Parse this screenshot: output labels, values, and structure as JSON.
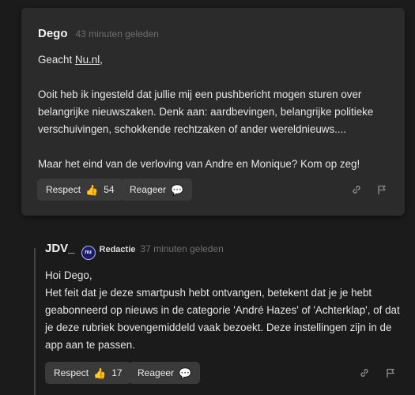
{
  "comment": {
    "author": "Dego",
    "time": "43 minuten geleden",
    "greeting_prefix": "Geacht ",
    "greeting_link": "Nu.nl",
    "greeting_suffix": ",",
    "lines": [
      "Ooit heb ik ingesteld dat jullie mij een pushbericht mogen sturen over",
      "belangrijke nieuwszaken. Denk aan: aardbevingen, belangrijke politieke",
      "verschuivingen, schokkende rechtzaken of ander wereldnieuws...."
    ],
    "closing": "Maar het eind van de verloving van Andre en Monique? Kom op zeg!",
    "respect_label": "Respect",
    "respect_count": "54",
    "reply_label": "Reageer"
  },
  "reply": {
    "author": "JDV_",
    "badge_logo": "nu",
    "badge_label": "Redactie",
    "time": "37 minuten geleden",
    "lines": [
      "Hoi Dego,",
      "Het feit dat je deze smartpush hebt ontvangen, betekent dat je je hebt",
      "geabonneerd op nieuws in de categorie 'André Hazes' of 'Achterklap', of dat",
      "je deze rubriek bovengemiddeld vaak bezoekt. Deze instellingen zijn in de",
      "app aan te passen."
    ],
    "respect_label": "Respect",
    "respect_count": "17",
    "reply_label": "Reageer"
  },
  "icons": {
    "thumbs_up": "👍",
    "comment_bubble": "💬",
    "link": "link-icon",
    "flag": "flag-icon"
  }
}
